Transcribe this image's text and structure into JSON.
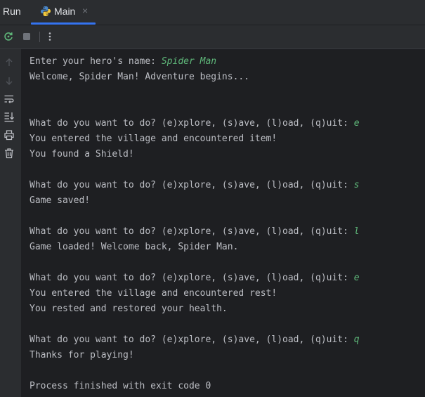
{
  "header": {
    "run_label": "Run",
    "tab": {
      "label": "Main",
      "close_glyph": "×",
      "icon": "python-icon"
    }
  },
  "toolbar": {
    "buttons": [
      "rerun-icon",
      "stop-icon",
      "more-options-icon"
    ]
  },
  "gutter": {
    "icons": [
      "arrow-up-icon",
      "arrow-down-icon",
      "soft-wrap-icon",
      "scroll-to-end-icon",
      "print-icon",
      "trash-icon"
    ]
  },
  "colors": {
    "accent": "#3574f0",
    "user_input": "#5fb87a",
    "text": "#bcbec4",
    "background": "#1e1f22"
  },
  "console": {
    "lines": [
      {
        "text": "Enter your hero's name: ",
        "input": "Spider Man"
      },
      {
        "text": "Welcome, Spider Man! Adventure begins...",
        "input": ""
      },
      {
        "text": "",
        "input": ""
      },
      {
        "text": "",
        "input": ""
      },
      {
        "text": "What do you want to do? (e)xplore, (s)ave, (l)oad, (q)uit: ",
        "input": "e"
      },
      {
        "text": "You entered the village and encountered item!",
        "input": ""
      },
      {
        "text": "You found a Shield!",
        "input": ""
      },
      {
        "text": "",
        "input": ""
      },
      {
        "text": "What do you want to do? (e)xplore, (s)ave, (l)oad, (q)uit: ",
        "input": "s"
      },
      {
        "text": "Game saved!",
        "input": ""
      },
      {
        "text": "",
        "input": ""
      },
      {
        "text": "What do you want to do? (e)xplore, (s)ave, (l)oad, (q)uit: ",
        "input": "l"
      },
      {
        "text": "Game loaded! Welcome back, Spider Man.",
        "input": ""
      },
      {
        "text": "",
        "input": ""
      },
      {
        "text": "What do you want to do? (e)xplore, (s)ave, (l)oad, (q)uit: ",
        "input": "e"
      },
      {
        "text": "You entered the village and encountered rest!",
        "input": ""
      },
      {
        "text": "You rested and restored your health.",
        "input": ""
      },
      {
        "text": "",
        "input": ""
      },
      {
        "text": "What do you want to do? (e)xplore, (s)ave, (l)oad, (q)uit: ",
        "input": "q"
      },
      {
        "text": "Thanks for playing!",
        "input": ""
      },
      {
        "text": "",
        "input": ""
      },
      {
        "text": "Process finished with exit code 0",
        "input": ""
      }
    ]
  }
}
